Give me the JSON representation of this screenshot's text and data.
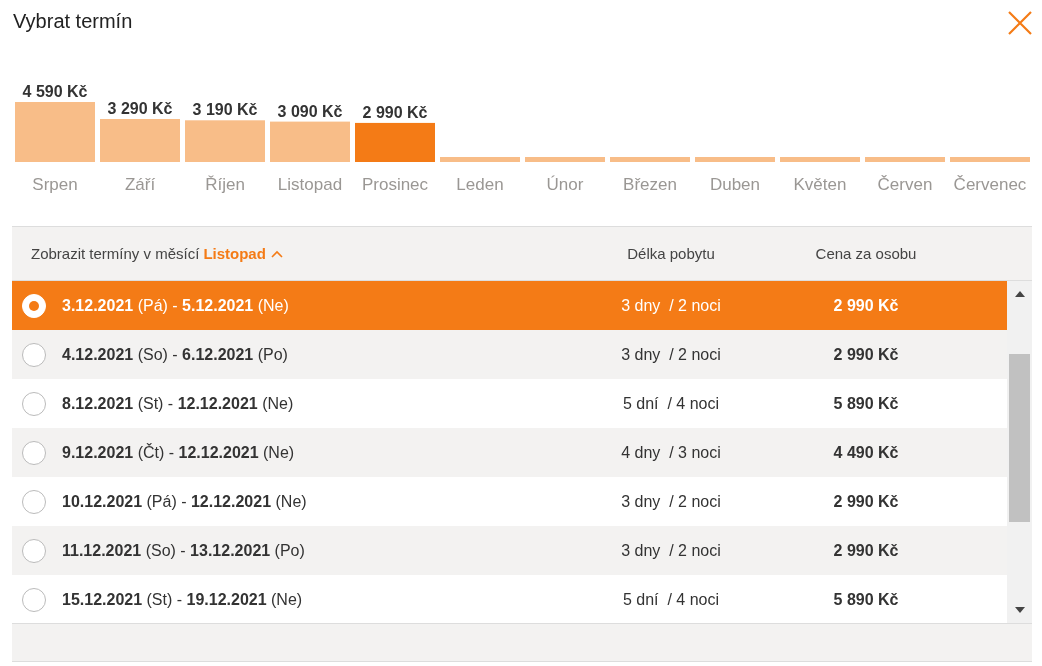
{
  "dialog": {
    "title": "Vybrat termín"
  },
  "price_chart": {
    "chart_data": {
      "type": "bar",
      "categories": [
        "Srpen",
        "Září",
        "Říjen",
        "Listopad",
        "Prosinec"
      ],
      "series": [
        {
          "color": "#f8bd88",
          "values": [
            4590,
            3290,
            3190,
            3090,
            null
          ],
          "value_labels": [
            "4 590 Kč",
            "3 290 Kč",
            "3 190 Kč",
            "3 090 Kč",
            null
          ]
        },
        {
          "color": "#f47b16",
          "values": [
            null,
            null,
            null,
            null,
            2990
          ],
          "value_labels": [
            null,
            null,
            null,
            null,
            "2 990 Kč"
          ]
        }
      ],
      "stacked": true
    },
    "months_without_price": [
      "Leden",
      "Únor",
      "Březen",
      "Duben",
      "Květen",
      "Červen",
      "Červenec"
    ]
  },
  "table": {
    "filter_label": "Zobrazit termíny v měsící",
    "filter_month": "Listopad",
    "columns": [
      "Délka pobytu",
      "Cena za osobu"
    ],
    "rows": [
      {
        "dates": "**3.12.2021** (Pá) - **5.12.2021** (Ne)",
        "length": "3 dny  / 2 noci",
        "price": "2 990 Kč",
        "selected": true
      },
      {
        "dates": "**4.12.2021** (So) - **6.12.2021** (Po)",
        "length": "3 dny  / 2 noci",
        "price": "2 990 Kč",
        "selected": false
      },
      {
        "dates": "**8.12.2021** (St) - **12.12.2021** (Ne)",
        "length": "5 dní  / 4 noci",
        "price": "5 890 Kč",
        "selected": false
      },
      {
        "dates": "**9.12.2021** (Čt) - **12.12.2021** (Ne)",
        "length": "4 dny  / 3 noci",
        "price": "4 490 Kč",
        "selected": false
      },
      {
        "dates": "**10.12.2021** (Pá) - **12.12.2021** (Ne)",
        "length": "3 dny  / 2 noci",
        "price": "2 990 Kč",
        "selected": false
      },
      {
        "dates": "**11.12.2021** (So) - **13.12.2021** (Po)",
        "length": "3 dny  / 2 noci",
        "price": "2 990 Kč",
        "selected": false
      },
      {
        "dates": "**15.12.2021** (St) - **19.12.2021** (Ne)",
        "length": "5 dní  / 4 noci",
        "price": "5 890 Kč",
        "selected": false
      }
    ]
  }
}
